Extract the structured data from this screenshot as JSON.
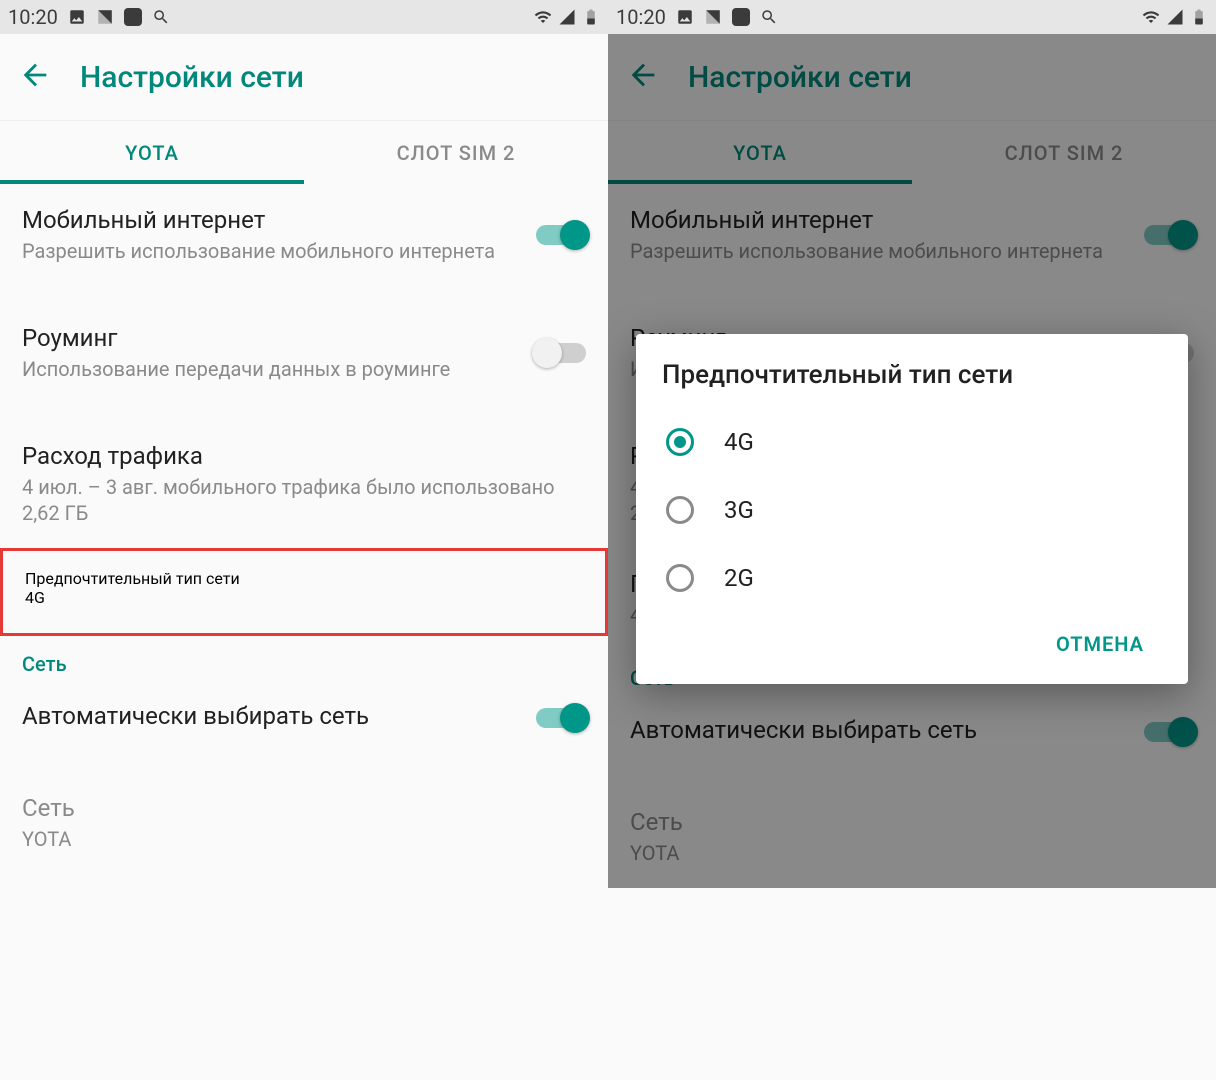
{
  "accent": "#009688",
  "statusbar": {
    "time": "10:20"
  },
  "appbar": {
    "title": "Настройки сети"
  },
  "tabs": {
    "a": "YOTA",
    "b": "СЛОТ SIM 2"
  },
  "items": {
    "mobile_data": {
      "title": "Мобильный интернет",
      "sub": "Разрешить использование мобильного интернета",
      "on": true
    },
    "roaming": {
      "title": "Роуминг",
      "sub": "Использование передачи данных в роуминге",
      "on": false
    },
    "usage": {
      "title": "Расход трафика",
      "sub": "4 июл. – 3 авг. мобильного трафика было использовано 2,62 ГБ"
    },
    "preferred": {
      "title": "Предпочтительный тип сети",
      "sub": "4G"
    },
    "section_network": "Сеть",
    "auto_select": {
      "title": "Автоматически выбирать сеть",
      "on": true
    },
    "network": {
      "title": "Сеть",
      "sub": "YOTA"
    }
  },
  "dialog": {
    "title": "Предпочтительный тип сети",
    "options": {
      "o1": "4G",
      "o2": "3G",
      "o3": "2G"
    },
    "cancel": "ОТМЕНА"
  }
}
